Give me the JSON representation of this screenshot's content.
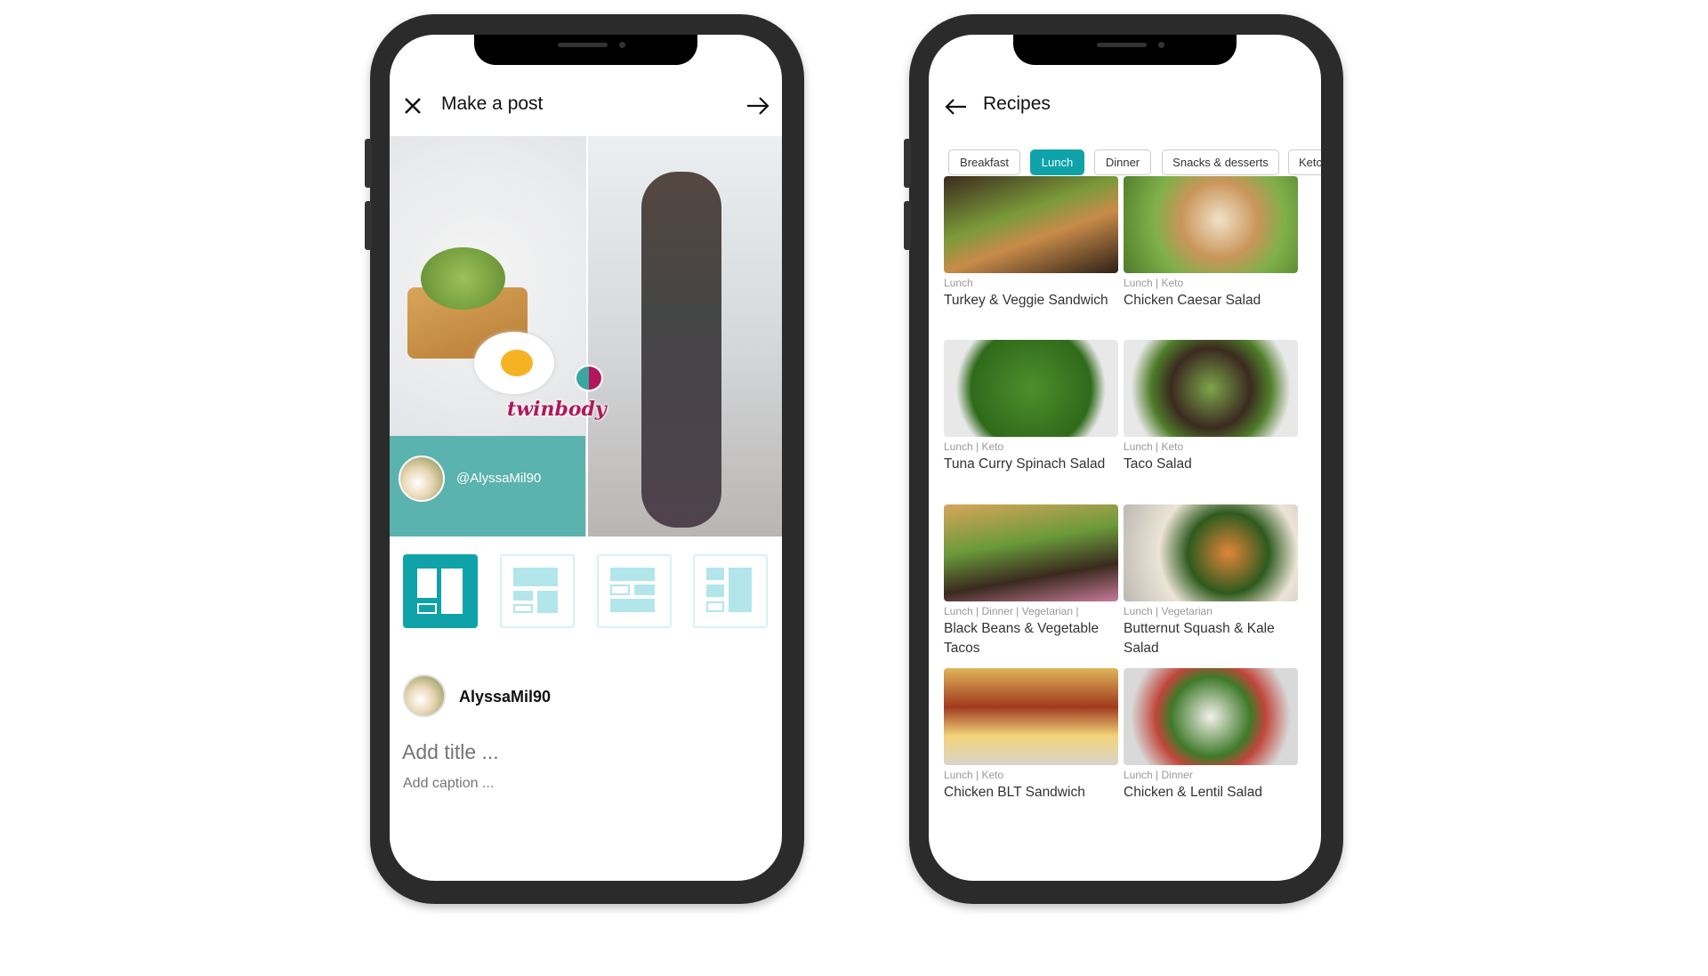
{
  "post_screen": {
    "title": "Make a post",
    "close_icon": "close-icon",
    "next_icon": "arrow-right-icon",
    "collage": {
      "handle": "@AlyssaMil90",
      "logo_text": "twinbody"
    },
    "layouts": [
      "two-column",
      "grid-mixed",
      "rows",
      "sidebar-left"
    ],
    "selected_layout": 0,
    "user": {
      "name": "AlyssaMil90"
    },
    "title_placeholder": "Add title ...",
    "caption_placeholder": "Add caption ..."
  },
  "recipes_screen": {
    "title": "Recipes",
    "back_icon": "arrow-left-icon",
    "filters": [
      "Breakfast",
      "Lunch",
      "Dinner",
      "Snacks & desserts",
      "Keto"
    ],
    "active_filter": "Lunch",
    "recipes": [
      {
        "tags": "Lunch",
        "name": "Turkey & Veggie Sandwich"
      },
      {
        "tags": "Lunch  |  Keto",
        "name": "Chicken Caesar Salad"
      },
      {
        "tags": "Lunch  |  Keto",
        "name": "Tuna Curry Spinach Salad"
      },
      {
        "tags": "Lunch  |  Keto",
        "name": "Taco Salad"
      },
      {
        "tags": "Lunch  |  Dinner  |  Vegetarian  |",
        "name": "Black Beans & Vegetable Tacos"
      },
      {
        "tags": "Lunch  |  Vegetarian",
        "name": "Butternut Squash & Kale Salad"
      },
      {
        "tags": "Lunch  |  Keto",
        "name": "Chicken BLT Sandwich"
      },
      {
        "tags": "Lunch  |  Dinner",
        "name": "Chicken & Lentil Salad"
      }
    ]
  },
  "colors": {
    "accent": "#0fa3a9",
    "panel": "#5ab3ae",
    "brand": "#b0185a",
    "layout_idle": "#b2e6ea"
  }
}
